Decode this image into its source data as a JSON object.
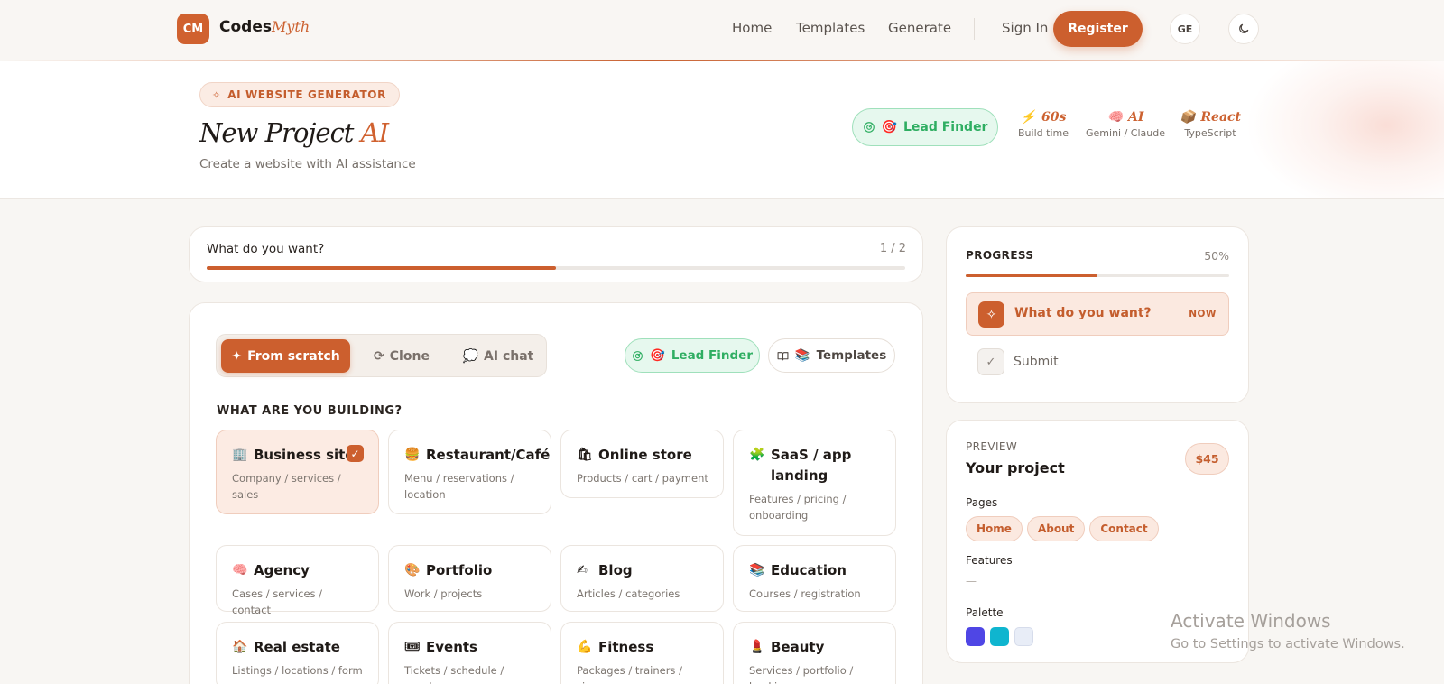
{
  "nav": {
    "logo_initials": "CM",
    "brand_main": "Codes",
    "brand_accent": "Myth",
    "links": [
      "Home",
      "Templates",
      "Generate"
    ],
    "sign_in": "Sign In",
    "register": "Register",
    "language": "GE",
    "theme_icon": "moon-icon"
  },
  "hero": {
    "pill": "AI WEBSITE GENERATOR",
    "title_main": "New Project",
    "title_accent": "AI",
    "subtitle": "Create a website with AI assistance",
    "lead_finder": "Lead Finder",
    "stats": [
      {
        "icon": "⚡",
        "value": "60s",
        "label": "Build time"
      },
      {
        "icon": "🧠",
        "value": "AI",
        "label": "Gemini / Claude"
      },
      {
        "icon": "📦",
        "value": "React",
        "label": "TypeScript"
      }
    ]
  },
  "step": {
    "label": "What do you want?",
    "count": "1 / 2",
    "progress": 0.5
  },
  "main": {
    "modes": [
      {
        "icon": "✦",
        "label": "From scratch",
        "active": true
      },
      {
        "icon": "⟳",
        "label": "Clone",
        "active": false
      },
      {
        "icon": "💭",
        "label": "AI chat",
        "active": false
      }
    ],
    "lead_finder": "Lead Finder",
    "templates": "Templates",
    "section_title": "WHAT ARE YOU BUILDING?",
    "tiles": [
      {
        "emoji": "🏢",
        "title": "Business site",
        "sub": "Company / services / sales",
        "selected": true
      },
      {
        "emoji": "🍔",
        "title": "Restaurant/Café",
        "sub": "Menu / reservations / location",
        "selected": false
      },
      {
        "emoji": "🛍",
        "title": "Online store",
        "sub": "Products / cart / payment",
        "selected": false
      },
      {
        "emoji": "🧩",
        "title": "SaaS / app landing",
        "sub": "Features / pricing / onboarding",
        "selected": false
      },
      {
        "emoji": "🧠",
        "title": "Agency",
        "sub": "Cases / services / contact",
        "selected": false
      },
      {
        "emoji": "🎨",
        "title": "Portfolio",
        "sub": "Work / projects",
        "selected": false
      },
      {
        "emoji": "✍",
        "title": "Blog",
        "sub": "Articles / categories",
        "selected": false
      },
      {
        "emoji": "📚",
        "title": "Education",
        "sub": "Courses / registration",
        "selected": false
      },
      {
        "emoji": "🏠",
        "title": "Real estate",
        "sub": "Listings / locations / form",
        "selected": false
      },
      {
        "emoji": "🎟",
        "title": "Events",
        "sub": "Tickets / schedule / speakers",
        "selected": false
      },
      {
        "emoji": "💪",
        "title": "Fitness",
        "sub": "Packages / trainers / signup",
        "selected": false
      },
      {
        "emoji": "💄",
        "title": "Beauty",
        "sub": "Services / portfolio / booking",
        "selected": false
      }
    ]
  },
  "progress": {
    "title": "PROGRESS",
    "percent": "50%",
    "fill": 0.5,
    "steps": [
      {
        "label": "What do you want?",
        "badge": "NOW",
        "active": true
      },
      {
        "label": "Submit",
        "active": false
      }
    ]
  },
  "preview": {
    "kicker": "PREVIEW",
    "title": "Your project",
    "price": "$45",
    "pages_label": "Pages",
    "pages": [
      "Home",
      "About",
      "Contact"
    ],
    "features_label": "Features",
    "features_empty": "—",
    "palette_label": "Palette",
    "palette": [
      "#4f46e5",
      "#0fb5cf",
      "#e8edf7"
    ]
  },
  "watermark": {
    "line1": "Activate Windows",
    "line2": "Go to Settings to activate Windows."
  },
  "colors": {
    "accent": "#cc5f2e",
    "green": "#2fae62",
    "background": "#f8f6f3"
  }
}
